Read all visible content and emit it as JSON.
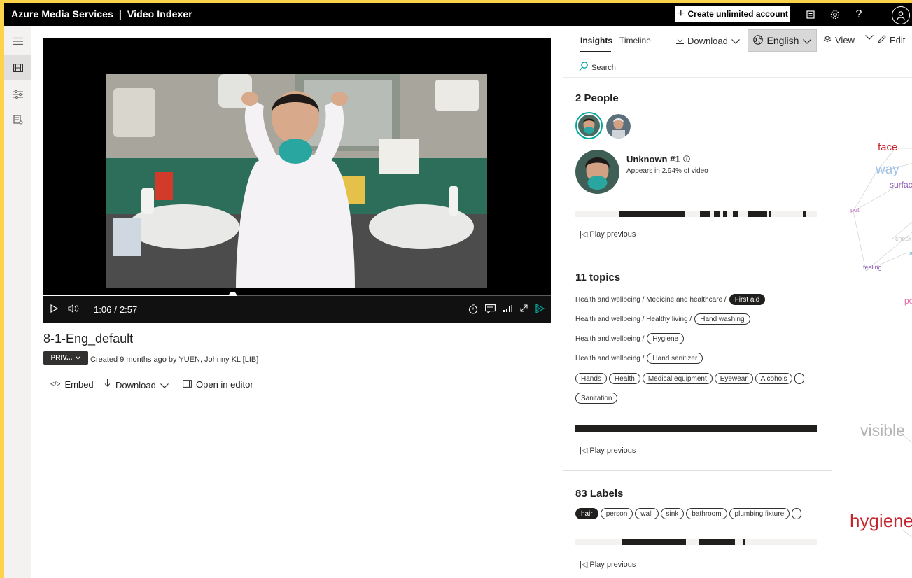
{
  "header": {
    "app_title": "Azure Media Services  |  Video Indexer",
    "create_account_label": "Create unlimited account"
  },
  "player": {
    "current_time": "1:06",
    "separator": "/",
    "duration": "2:57",
    "progress": 0.373
  },
  "video": {
    "title": "8-1-Eng_default",
    "privacy_label": "PRIV...",
    "created_text": "Created 9 months ago by YUEN, Johnny KL [LIB]"
  },
  "actions": {
    "embed_label": "Embed",
    "download_label": "Download",
    "open_editor_label": "Open in editor"
  },
  "panel": {
    "tabs": [
      {
        "label": "Insights",
        "active": true
      },
      {
        "label": "Timeline",
        "active": false
      }
    ],
    "download_label": "Download",
    "language_label": "English",
    "view_label": "View",
    "edit_label": "Edit",
    "search_label": "Search"
  },
  "people": {
    "heading": "2 People",
    "selected_name": "Unknown #1",
    "appears_text": "Appears in 2.94% of video",
    "play_previous_label": "Play previous"
  },
  "topics": {
    "heading": "11 topics",
    "rows": [
      {
        "path": "Health and wellbeing / Medicine and healthcare /",
        "tag": "First aid",
        "dark": true
      },
      {
        "path": "Health and wellbeing / Healthy living /",
        "tag": "Hand washing",
        "dark": false
      },
      {
        "path": "Health and wellbeing /",
        "tag": "Hygiene",
        "dark": false
      },
      {
        "path": "Health and wellbeing /",
        "tag": "Hand sanitizer",
        "dark": false
      }
    ],
    "keywords": [
      "Hands",
      "Health",
      "Medical equipment",
      "Eyewear",
      "Alcohols"
    ],
    "keywords_row2": [
      "Sanitation"
    ],
    "play_previous_label": "Play previous"
  },
  "labels": {
    "heading": "83 Labels",
    "items": [
      "hair",
      "person",
      "wall",
      "sink",
      "bathroom",
      "plumbing fixture"
    ],
    "play_previous_label": "Play previous"
  },
  "word_cloud": {
    "words": [
      {
        "text": "face",
        "color": "#c4262e"
      },
      {
        "text": "way",
        "color": "#9fc3e6"
      },
      {
        "text": "surface",
        "color": "#8e5bb5"
      },
      {
        "text": "put",
        "color": "#b86ab8"
      },
      {
        "text": "check",
        "color": "#c8c8c8"
      },
      {
        "text": "an",
        "color": "#6fb6d9"
      },
      {
        "text": "feeling",
        "color": "#8e5bb5"
      },
      {
        "text": "pos",
        "color": "#e46aa8"
      },
      {
        "text": "visible",
        "color": "#b3b3b3"
      },
      {
        "text": "hygiene",
        "color": "#c4262e"
      }
    ]
  },
  "colors": {
    "frame": "#fbd44b",
    "topbar": "#000000",
    "accent": "#00a99d"
  }
}
